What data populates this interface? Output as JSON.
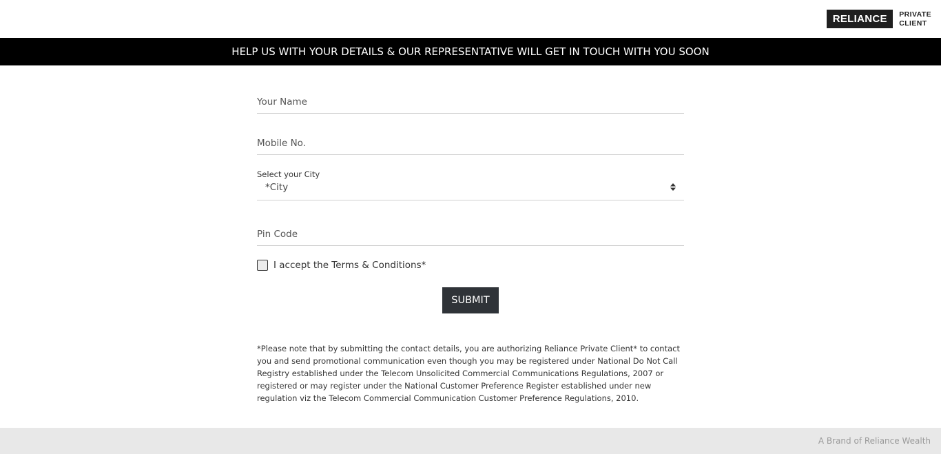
{
  "header": {
    "logo_main": "RELIANCE",
    "logo_sub_line1": "PRIVATE",
    "logo_sub_line2": "CLIENT"
  },
  "banner": {
    "text": "HELP US WITH YOUR DETAILS & OUR REPRESENTATIVE WILL GET IN TOUCH WITH YOU SOON"
  },
  "form": {
    "name_placeholder": "Your Name",
    "mobile_placeholder": "Mobile No.",
    "city_label": "Select your City",
    "city_selected": "*City",
    "pin_placeholder": "Pin Code",
    "terms_label": "I accept the Terms & Conditions*",
    "submit_label": "SUBMIT",
    "disclaimer": "*Please note that by submitting the contact details, you are authorizing Reliance Private Client* to contact you and send promotional communication even though you may be registered under National Do Not Call Registry established under the Telecom Unsolicited Commercial Communications Regulations, 2007 or registered or may register under the National Customer Preference Register established under new regulation viz the Telecom Commercial Communication Customer Preference Regulations, 2010."
  },
  "footer": {
    "text": "A Brand of Reliance Wealth"
  },
  "colors": {
    "banner_bg": "#000000",
    "submit_bg": "#2f3338",
    "footer_bg": "#e8e8e8"
  },
  "icons": {
    "select_arrow": "sort-icon"
  }
}
